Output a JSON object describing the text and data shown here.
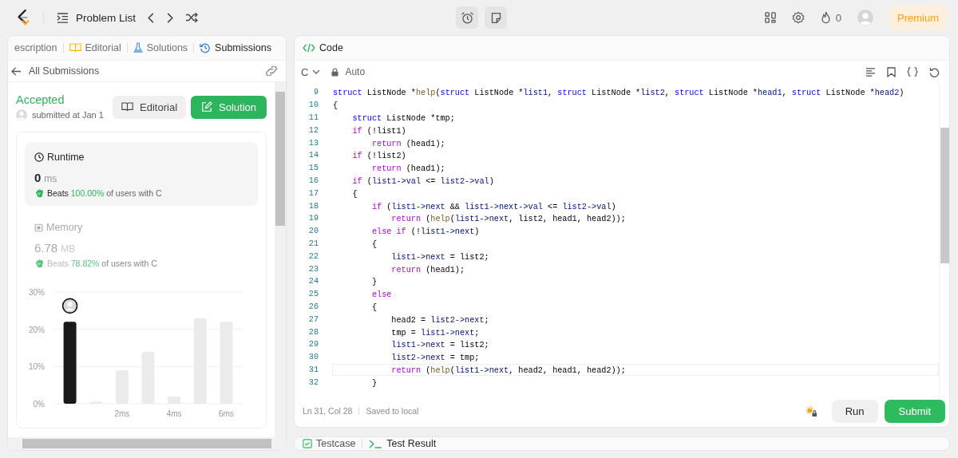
{
  "nav": {
    "title": "Problem List"
  },
  "topbar": {
    "streak": "0",
    "premium": "Premium"
  },
  "left_tabs": [
    {
      "label": "escription",
      "selected": false
    },
    {
      "label": "Editorial",
      "selected": false
    },
    {
      "label": "Solutions",
      "selected": false
    },
    {
      "label": "Submissions",
      "selected": true
    }
  ],
  "submission": {
    "back": "All Submissions",
    "status": "Accepted",
    "submitted": "submitted at Jan 1",
    "editorial_button": "Editorial",
    "solution_button": "Solution"
  },
  "metrics": [
    {
      "kind": "runtime",
      "title": "Runtime",
      "value": "0",
      "unit": "ms",
      "beats_label": "Beats",
      "beats": "100.00%",
      "suffix": "of users with C",
      "selected": true
    },
    {
      "kind": "memory",
      "title": "Memory",
      "value": "6.78",
      "unit": "MB",
      "beats_label": "Beats",
      "beats": "78.82%",
      "suffix": "of users with C",
      "selected": false
    }
  ],
  "distribution": {
    "chart_data": {
      "type": "bar",
      "x": [
        0,
        1,
        2,
        3,
        4,
        5,
        6
      ],
      "series": [
        {
          "color": "#1a1a1a",
          "values": [
            22,
            null,
            null,
            null,
            null,
            null,
            null
          ]
        },
        {
          "color": "#ebebeb",
          "values": [
            null,
            0.6,
            9,
            14,
            2,
            23,
            22
          ]
        }
      ],
      "xlim": [
        -0.6,
        6.6
      ],
      "ylim": [
        0,
        30
      ],
      "yticks": [
        {
          "value": 0,
          "label": "0%"
        },
        {
          "value": 10,
          "label": "10%"
        },
        {
          "value": 20,
          "label": "20%"
        },
        {
          "value": 30,
          "label": "30%"
        }
      ],
      "xticks": [
        {
          "value": 2,
          "label": "2ms"
        },
        {
          "value": 4,
          "label": "4ms"
        },
        {
          "value": 6,
          "label": "6ms"
        }
      ]
    }
  },
  "editor": {
    "title": "Code",
    "language": "C",
    "mode": "Auto",
    "lines": [
      {
        "number": "9",
        "current": false,
        "tokens": [
          {
            "text": "struct",
            "kind": "type"
          },
          {
            "text": " ListNode *",
            "kind": "plain"
          },
          {
            "text": "help",
            "kind": "func"
          },
          {
            "text": "(",
            "kind": "plain"
          },
          {
            "text": "struct",
            "kind": "type"
          },
          {
            "text": " ListNode *",
            "kind": "plain"
          },
          {
            "text": "list1",
            "kind": "var"
          },
          {
            "text": ", ",
            "kind": "plain"
          },
          {
            "text": "struct",
            "kind": "type"
          },
          {
            "text": " ListNode *",
            "kind": "plain"
          },
          {
            "text": "list2",
            "kind": "var"
          },
          {
            "text": ", ",
            "kind": "plain"
          },
          {
            "text": "struct",
            "kind": "type"
          },
          {
            "text": " ListNode *",
            "kind": "plain"
          },
          {
            "text": "head1",
            "kind": "var"
          },
          {
            "text": ", ",
            "kind": "plain"
          },
          {
            "text": "struct",
            "kind": "type"
          },
          {
            "text": " ListNode *",
            "kind": "plain"
          },
          {
            "text": "head2",
            "kind": "var"
          },
          {
            "text": ")",
            "kind": "plain"
          }
        ]
      },
      {
        "number": "10",
        "current": false,
        "tokens": [
          {
            "text": "{",
            "kind": "plain"
          }
        ]
      },
      {
        "number": "11",
        "current": false,
        "tokens": [
          {
            "text": "    struct",
            "kind": "type"
          },
          {
            "text": " ListNode *tmp;",
            "kind": "plain"
          }
        ]
      },
      {
        "number": "12",
        "current": false,
        "tokens": [
          {
            "text": "    if",
            "kind": "ctrl"
          },
          {
            "text": " (!list1)",
            "kind": "plain"
          }
        ]
      },
      {
        "number": "13",
        "current": false,
        "tokens": [
          {
            "text": "        return",
            "kind": "ctrl"
          },
          {
            "text": " (head1);",
            "kind": "plain"
          }
        ]
      },
      {
        "number": "14",
        "current": false,
        "tokens": [
          {
            "text": "    if",
            "kind": "ctrl"
          },
          {
            "text": " (!list2)",
            "kind": "plain"
          }
        ]
      },
      {
        "number": "15",
        "current": false,
        "tokens": [
          {
            "text": "        return",
            "kind": "ctrl"
          },
          {
            "text": " (head1);",
            "kind": "plain"
          }
        ]
      },
      {
        "number": "16",
        "current": false,
        "tokens": [
          {
            "text": "    if",
            "kind": "ctrl"
          },
          {
            "text": " (",
            "kind": "plain"
          },
          {
            "text": "list1->val",
            "kind": "var"
          },
          {
            "text": " <= ",
            "kind": "plain"
          },
          {
            "text": "list2->val",
            "kind": "var"
          },
          {
            "text": ")",
            "kind": "plain"
          }
        ]
      },
      {
        "number": "17",
        "current": false,
        "tokens": [
          {
            "text": "    {",
            "kind": "plain"
          }
        ]
      },
      {
        "number": "18",
        "current": false,
        "tokens": [
          {
            "text": "        if",
            "kind": "ctrl"
          },
          {
            "text": " (",
            "kind": "plain"
          },
          {
            "text": "list1->next",
            "kind": "var"
          },
          {
            "text": " && ",
            "kind": "plain"
          },
          {
            "text": "list1->next->val",
            "kind": "var"
          },
          {
            "text": " <= ",
            "kind": "plain"
          },
          {
            "text": "list2->val",
            "kind": "var"
          },
          {
            "text": ")",
            "kind": "plain"
          }
        ]
      },
      {
        "number": "19",
        "current": false,
        "tokens": [
          {
            "text": "            return",
            "kind": "ctrl"
          },
          {
            "text": " (",
            "kind": "plain"
          },
          {
            "text": "help",
            "kind": "func"
          },
          {
            "text": "(",
            "kind": "plain"
          },
          {
            "text": "list1->next",
            "kind": "var"
          },
          {
            "text": ", list2, head1, head2));",
            "kind": "plain"
          }
        ]
      },
      {
        "number": "20",
        "current": false,
        "tokens": [
          {
            "text": "        else if",
            "kind": "ctrl"
          },
          {
            "text": " (!",
            "kind": "plain"
          },
          {
            "text": "list1->next",
            "kind": "var"
          },
          {
            "text": ")",
            "kind": "plain"
          }
        ]
      },
      {
        "number": "21",
        "current": false,
        "tokens": [
          {
            "text": "        {",
            "kind": "plain"
          }
        ]
      },
      {
        "number": "22",
        "current": false,
        "tokens": [
          {
            "text": "            list1->next",
            "kind": "var"
          },
          {
            "text": " = list2;",
            "kind": "plain"
          }
        ]
      },
      {
        "number": "23",
        "current": false,
        "tokens": [
          {
            "text": "            return",
            "kind": "ctrl"
          },
          {
            "text": " (head1);",
            "kind": "plain"
          }
        ]
      },
      {
        "number": "24",
        "current": false,
        "tokens": [
          {
            "text": "        }",
            "kind": "plain"
          }
        ]
      },
      {
        "number": "25",
        "current": false,
        "tokens": [
          {
            "text": "        else",
            "kind": "ctrl"
          }
        ]
      },
      {
        "number": "26",
        "current": false,
        "tokens": [
          {
            "text": "        {",
            "kind": "plain"
          }
        ]
      },
      {
        "number": "27",
        "current": false,
        "tokens": [
          {
            "text": "            head2 = ",
            "kind": "plain"
          },
          {
            "text": "list2->next",
            "kind": "var"
          },
          {
            "text": ";",
            "kind": "plain"
          }
        ]
      },
      {
        "number": "28",
        "current": false,
        "tokens": [
          {
            "text": "            tmp = ",
            "kind": "plain"
          },
          {
            "text": "list1->next",
            "kind": "var"
          },
          {
            "text": ";",
            "kind": "plain"
          }
        ]
      },
      {
        "number": "29",
        "current": false,
        "tokens": [
          {
            "text": "            list1->next",
            "kind": "var"
          },
          {
            "text": " = list2;",
            "kind": "plain"
          }
        ]
      },
      {
        "number": "30",
        "current": false,
        "tokens": [
          {
            "text": "            list2->next",
            "kind": "var"
          },
          {
            "text": " = tmp;",
            "kind": "plain"
          }
        ]
      },
      {
        "number": "31",
        "current": true,
        "tokens": [
          {
            "text": "            return",
            "kind": "ctrl"
          },
          {
            "text": " (",
            "kind": "plain"
          },
          {
            "text": "help",
            "kind": "func"
          },
          {
            "text": "(",
            "kind": "plain"
          },
          {
            "text": "list1->next",
            "kind": "var"
          },
          {
            "text": ", head2, head1, head2));",
            "kind": "plain"
          }
        ]
      },
      {
        "number": "32",
        "current": false,
        "tokens": [
          {
            "text": "        }",
            "kind": "plain"
          }
        ]
      }
    ],
    "position": "Ln 31, Col 28",
    "saved": "Saved to local",
    "run": "Run",
    "submit": "Submit"
  },
  "bottom_tabs": [
    {
      "label": "Testcase"
    },
    {
      "label": "Test Result"
    }
  ]
}
